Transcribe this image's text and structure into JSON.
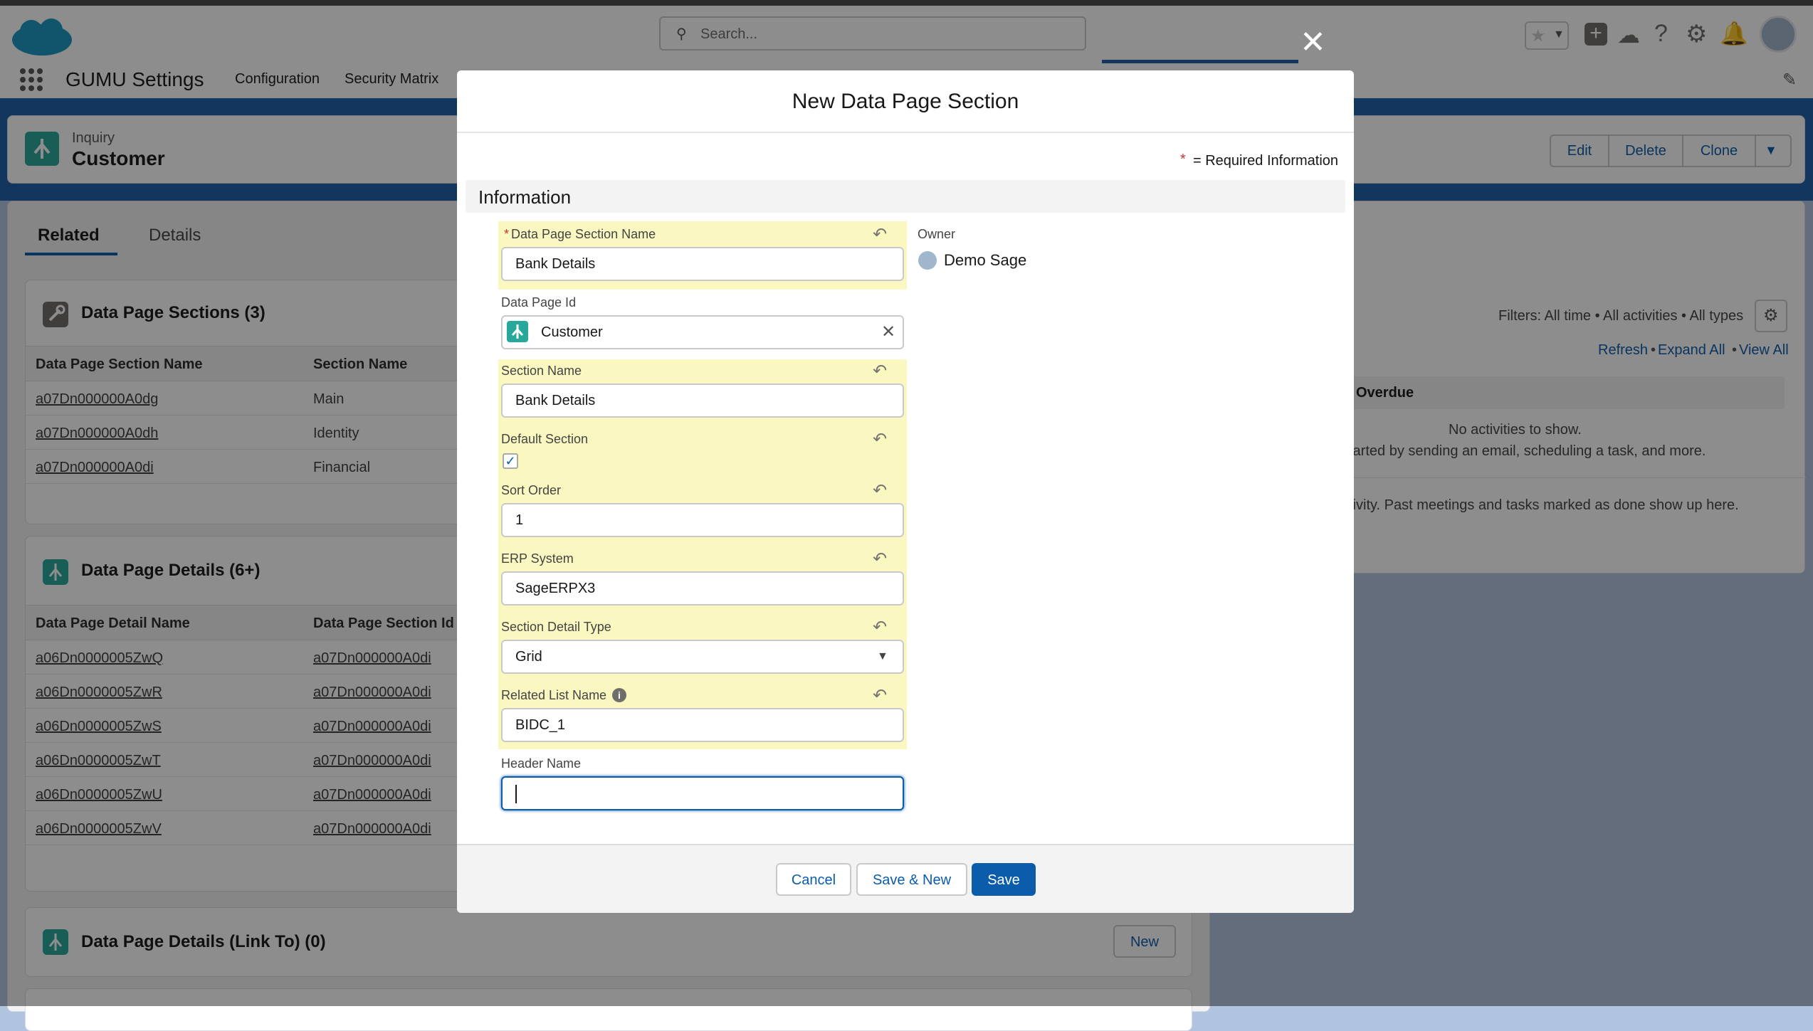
{
  "app": {
    "name": "GUMU Settings",
    "nav_items": [
      "Configuration",
      "Security Matrix"
    ],
    "search_placeholder": "Search..."
  },
  "record": {
    "object_label": "Inquiry",
    "title": "Customer",
    "actions": [
      "Edit",
      "Delete",
      "Clone"
    ]
  },
  "tabs": [
    "Related",
    "Details"
  ],
  "sections_card": {
    "title": "Data Page Sections (3)",
    "columns": [
      "Data Page Section Name",
      "Section Name"
    ],
    "rows": [
      [
        "a07Dn000000A0dg",
        "Main"
      ],
      [
        "a07Dn000000A0dh",
        "Identity"
      ],
      [
        "a07Dn000000A0di",
        "Financial"
      ]
    ]
  },
  "details_card": {
    "title": "Data Page Details (6+)",
    "columns": [
      "Data Page Detail Name",
      "Data Page Section Id"
    ],
    "rows": [
      [
        "a06Dn0000005ZwQ",
        "a07Dn000000A0di"
      ],
      [
        "a06Dn0000005ZwR",
        "a07Dn000000A0di"
      ],
      [
        "a06Dn0000005ZwS",
        "a07Dn000000A0di"
      ],
      [
        "a06Dn0000005ZwT",
        "a07Dn000000A0di"
      ],
      [
        "a06Dn0000005ZwU",
        "a07Dn000000A0di"
      ],
      [
        "a06Dn0000005ZwV",
        "a07Dn000000A0di"
      ]
    ]
  },
  "linkto_card": {
    "title": "Data Page Details (Link To) (0)",
    "new_label": "New"
  },
  "activity": {
    "filters": "Filters: All time • All activities • All types",
    "refresh": "Refresh",
    "expand_all": "Expand All",
    "view_all": "View All",
    "overdue": "& Overdue",
    "no_activities": "No activities to show.",
    "started": "started by sending an email, scheduling a task, and more.",
    "past": "ctivity. Past meetings and tasks marked as done show up here."
  },
  "modal": {
    "title": "New Data Page Section",
    "required_note": "= Required Information",
    "section_title": "Information",
    "fields": {
      "name_label": "Data Page Section Name",
      "name_value": "Bank Details",
      "page_id_label": "Data Page Id",
      "page_id_value": "Customer",
      "section_name_label": "Section Name",
      "section_name_value": "Bank Details",
      "default_label": "Default Section",
      "sort_label": "Sort Order",
      "sort_value": "1",
      "erp_label": "ERP System",
      "erp_value": "SageERPX3",
      "detail_type_label": "Section Detail Type",
      "detail_type_value": "Grid",
      "related_label": "Related List Name",
      "related_value": "BIDC_1",
      "header_label": "Header Name",
      "header_value": ""
    },
    "owner_label": "Owner",
    "owner_value": "Demo Sage",
    "buttons": {
      "cancel": "Cancel",
      "save_new": "Save & New",
      "save": "Save"
    }
  },
  "colors": {
    "brand_blue": "#0b5cab",
    "highlight_yellow": "#faf8c0",
    "record_icon_teal": "#26a89a"
  }
}
